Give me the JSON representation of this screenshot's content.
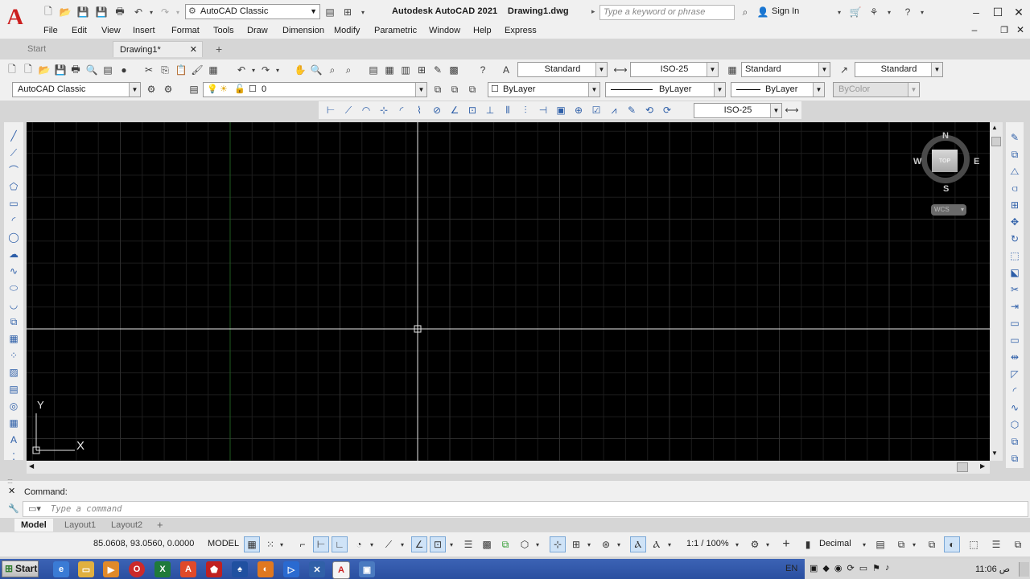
{
  "app": {
    "logo": "A",
    "title": "Autodesk AutoCAD 2021",
    "document": "Drawing1.dwg",
    "workspace": "AutoCAD Classic",
    "search_placeholder": "Type a keyword or phrase",
    "sign_in": "Sign In"
  },
  "menubar": [
    "File",
    "Edit",
    "View",
    "Insert",
    "Format",
    "Tools",
    "Draw",
    "Dimension",
    "Modify",
    "Parametric",
    "Window",
    "Help",
    "Express"
  ],
  "tabs": {
    "start": "Start",
    "drawing": "Drawing1*",
    "close": "✕",
    "add": "+"
  },
  "styles_toolbar": {
    "text_style": "Standard",
    "dim_style": "ISO-25",
    "table_style": "Standard",
    "mleader_style": "Standard"
  },
  "layers_toolbar": {
    "workspace": "AutoCAD Classic",
    "layer": "0",
    "color": "ByLayer",
    "linetype": "ByLayer",
    "lineweight": "ByLayer",
    "plotstyle": "ByColor"
  },
  "dim_toolbar": {
    "dim_style": "ISO-25"
  },
  "viewcube": {
    "north": "N",
    "south": "S",
    "east": "E",
    "west": "W",
    "face": "TOP",
    "ucs": "WCS"
  },
  "ucs_icon": {
    "x": "X",
    "y": "Y"
  },
  "command": {
    "history": "Command:",
    "placeholder": "Type a command"
  },
  "layout_tabs": [
    "Model",
    "Layout1",
    "Layout2"
  ],
  "layout_add": "+",
  "statusbar": {
    "coordinates": "85.0608, 93.0560, 0.0000",
    "space": "MODEL",
    "annotation_scale": "1:1 / 100%",
    "units": "Decimal"
  },
  "taskbar": {
    "start": "Start",
    "lang": "EN",
    "time": "11:06",
    "ampm": "ص"
  },
  "colors": {
    "canvas": "#000000",
    "grid_minor": "#1c1c1c",
    "grid_major": "#2e2e2e",
    "y_axis": "#1f5a1f",
    "crosshair": "#ffffff",
    "logo": "#cc1f1f"
  }
}
